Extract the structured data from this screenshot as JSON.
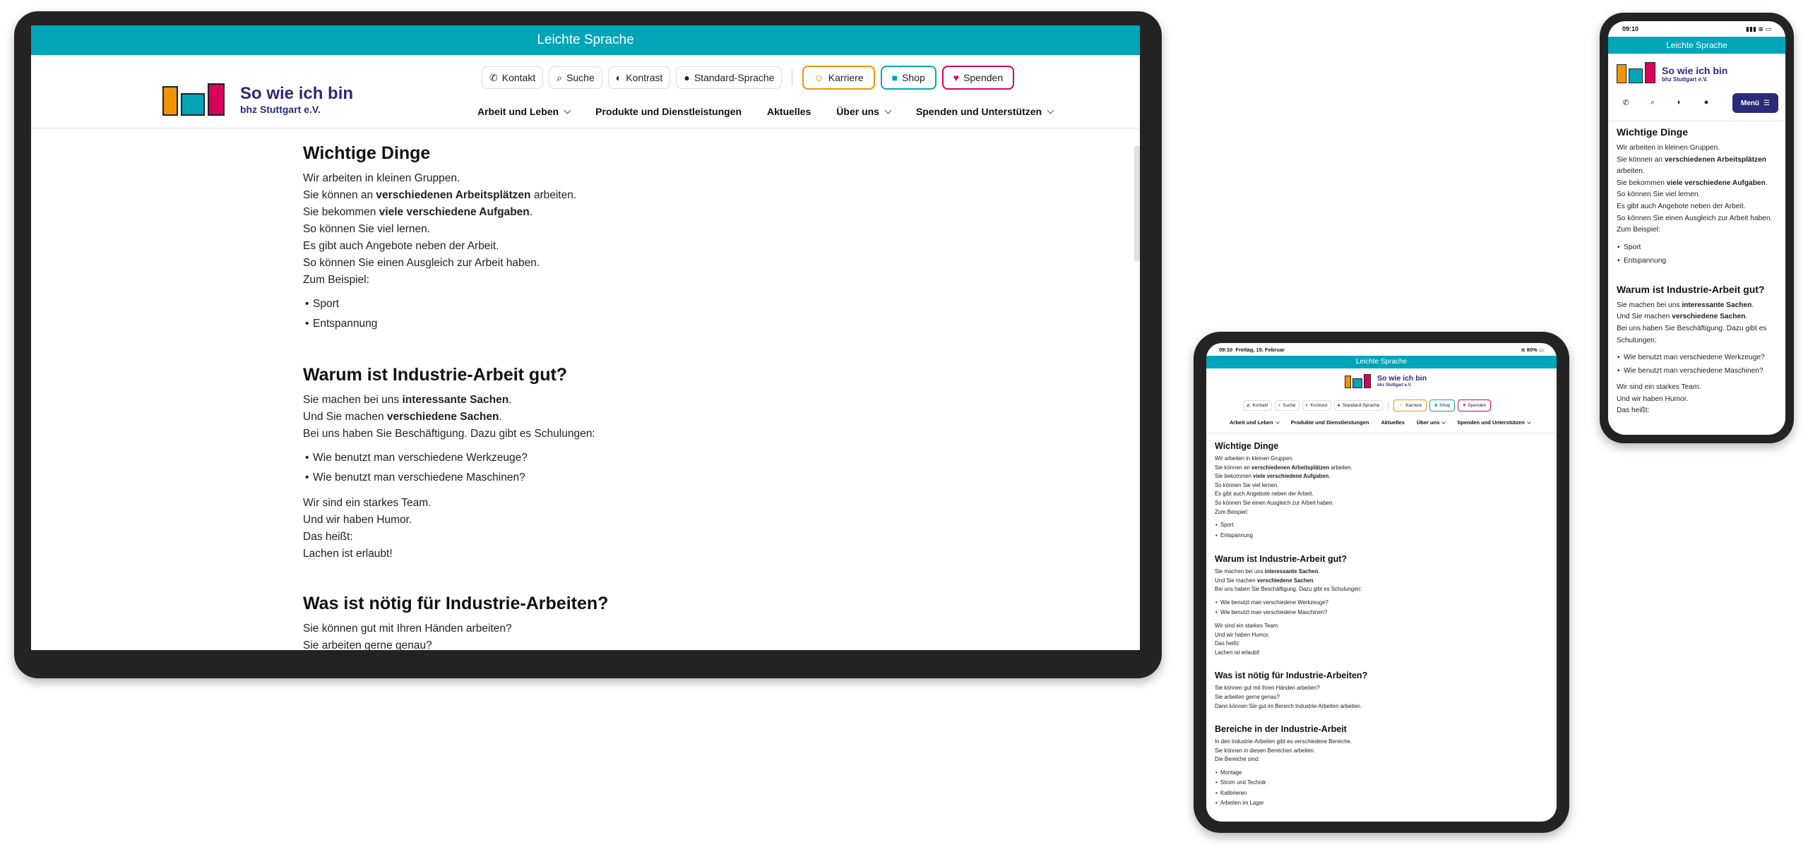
{
  "colors": {
    "teal": "#00a5b8",
    "orange": "#f29400",
    "pink": "#d9005b",
    "navy": "#2b2a7a"
  },
  "topbar": {
    "label": "Leichte Sprache"
  },
  "logo": {
    "title": "So wie ich bin",
    "subtitle": "bhz Stuttgart e.V."
  },
  "utility": {
    "kontakt": "Kontakt",
    "suche": "Suche",
    "kontrast": "Kontrast",
    "standard": "Standard-Sprache"
  },
  "cta": {
    "karriere": "Karriere",
    "shop": "Shop",
    "spenden": "Spenden"
  },
  "nav": {
    "arbeit": "Arbeit und Leben",
    "produkte": "Produkte und Dienstleistungen",
    "aktuelles": "Aktuelles",
    "ueber": "Über uns",
    "spenden": "Spenden und Unterstützen"
  },
  "status": {
    "tablet_time": "09:10",
    "tablet_date": "Freitag, 15. Februar",
    "tablet_battery": "80%",
    "phone_time": "09:10"
  },
  "menu": {
    "label": "Menü"
  },
  "content": {
    "s1": {
      "title": "Wichtige Dinge",
      "l1": "Wir arbeiten in kleinen Gruppen.",
      "l2a": "Sie können an ",
      "l2b": "verschiedenen Arbeitsplätzen",
      "l2c": " arbeiten.",
      "l3a": "Sie bekommen ",
      "l3b": "viele verschiedene Aufgaben",
      "l3c": ".",
      "l4": "So können Sie viel lernen.",
      "l5": "Es gibt auch Angebote neben der Arbeit.",
      "l6": "So können Sie einen Ausgleich zur Arbeit haben.",
      "l7": "Zum Beispiel:",
      "items": [
        "Sport",
        "Entspannung"
      ]
    },
    "s2": {
      "title": "Warum ist Industrie-Arbeit gut?",
      "l1a": "Sie machen bei uns ",
      "l1b": "interessante Sachen",
      "l1c": ".",
      "l2a": "Und Sie machen ",
      "l2b": "verschiedene Sachen",
      "l2c": ".",
      "l3": "Bei uns haben Sie Beschäftigung. Dazu gibt es Schulungen:",
      "items": [
        "Wie benutzt man verschiedene Werkzeuge?",
        "Wie benutzt man verschiedene Maschinen?"
      ],
      "p1": "Wir sind ein starkes Team.",
      "p2": "Und wir haben Humor.",
      "p3": "Das heißt:",
      "p4": "Lachen ist erlaubt!"
    },
    "s3": {
      "title": "Was ist nötig für Industrie-Arbeiten?",
      "l1": "Sie können gut mit Ihren Händen arbeiten?",
      "l2": "Sie arbeiten gerne genau?",
      "l3": "Dann können Sie gut im Bereich Industrie-Arbeiten arbeiten."
    },
    "s4": {
      "title": "Bereiche in der Industrie-Arbeit",
      "l1": "In den Industrie-Arbeiten gibt es verschiedene Bereiche.",
      "l2": "Sie können in diesen Bereichen arbeiten.",
      "l3": "Die Bereiche sind:",
      "items": [
        "Montage",
        "Strom und Technik",
        "Kalibrieren",
        "Arbeiten im Lager"
      ]
    }
  }
}
